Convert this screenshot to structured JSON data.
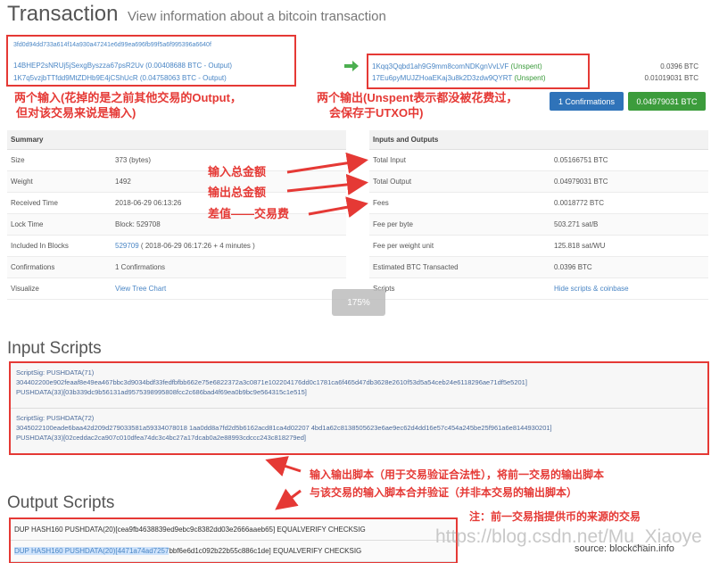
{
  "header": {
    "title": "Transaction",
    "subtitle": "View information about a bitcoin transaction"
  },
  "tx": {
    "hash": "3fd0d94dd733a614f14a930a47241e6d99ea696fb99f5a6f995396a6640f",
    "inputs": [
      {
        "address": "14BHEP2sNRUj5jSexgByszza67psR2Uv",
        "amount": "(0.00408688 BTC - Output)"
      },
      {
        "address": "1K7q5vzjbTTfdd9MtZDHb9E4jCShUcR",
        "amount": "(0.04758063 BTC - Output)"
      }
    ],
    "outputs": [
      {
        "address": "1Kqq3Qqbd1ah9G9mm8comNDKgnVvLVF",
        "status": "(Unspent)",
        "amount": "0.0396 BTC"
      },
      {
        "address": "17Eu6pyMUJZHoaEKaj3u8k2D3zdw9QYRT",
        "status": "(Unspent)",
        "amount": "0.01019031 BTC"
      }
    ],
    "confirmations_button": "1 Confirmations",
    "total_button": "0.04979031 BTC"
  },
  "notes": {
    "inputs_line1": "两个输入(花掉的是之前其他交易的Output，",
    "inputs_line2": "但对该交易来说是输入)",
    "outputs_line1": "两个输出(Unspent表示都没被花费过，",
    "outputs_line2": "会保存于UTXO中)",
    "total_input": "输入总金额",
    "total_output": "输出总金额",
    "fee": "差值——交易费",
    "scripts_line1": "输入输出脚本（用于交易验证合法性），将前一交易的输出脚本",
    "scripts_line2": "与该交易的输入脚本合并验证（并非本交易的输出脚本）",
    "prev_tx": "注：前一交易指提供币的来源的交易"
  },
  "summary": {
    "heading": "Summary",
    "rows": [
      {
        "key": "Size",
        "value": "373 (bytes)"
      },
      {
        "key": "Weight",
        "value": "1492"
      },
      {
        "key": "Received Time",
        "value": "2018-06-29 06:13:26"
      },
      {
        "key": "Lock Time",
        "value": "Block: 529708"
      },
      {
        "key": "Included In Blocks",
        "value_link": "529709",
        "value_rest": " ( 2018-06-29 06:17:26 + 4 minutes )"
      },
      {
        "key": "Confirmations",
        "value": "1 Confirmations"
      },
      {
        "key": "Visualize",
        "value_link": "View Tree Chart",
        "value_rest": ""
      }
    ]
  },
  "io": {
    "heading": "Inputs and Outputs",
    "rows": [
      {
        "key": "Total Input",
        "value": "0.05166751 BTC"
      },
      {
        "key": "Total Output",
        "value": "0.04979031 BTC"
      },
      {
        "key": "Fees",
        "value": "0.0018772 BTC"
      },
      {
        "key": "Fee per byte",
        "value": "503.271 sat/B"
      },
      {
        "key": "Fee per weight unit",
        "value": "125.818 sat/WU"
      },
      {
        "key": "Estimated BTC Transacted",
        "value": "0.0396 BTC"
      },
      {
        "key": "Scripts",
        "value_link": "Hide scripts & coinbase",
        "value_rest": ""
      }
    ]
  },
  "zoom": "175%",
  "input_scripts": {
    "title": "Input Scripts",
    "blocks": [
      {
        "line1": "ScriptSig: PUSHDATA(71)",
        "line2": "304402200e902feaaf8e49ea467bbc3d9034bdf33fedfbfbb662e75e6822372a3c0871e102204176dd0c1781ca6f465d47db3628e2610f53d5a54ceb24e6118296ae71df5e5201]",
        "line3": "PUSHDATA(33)[03b339dc9b56131ad9575398995808fcc2c686bad4f69ea0b9bc9e564315c1e515]"
      },
      {
        "line1": "ScriptSig: PUSHDATA(72)",
        "line2": "3045022100eade6baa42d209d279033581a59334078018 1aa0dd8a7fd2d5b6162acd81ca4d02207 4bd1a62c8138505623e6ae9ec62d4dd16e57c454a245be25f961a6e8144930201]",
        "line3": "PUSHDATA(33)[02ceddac2ca907c010dfea74dc3c4bc27a17dcab0a2e88993cdccc243c818279ed]"
      }
    ]
  },
  "output_scripts": {
    "title": "Output Scripts",
    "rows": [
      {
        "pre": "DUP HASH160 PUSHDATA(20)[cea9fb4638839ed9ebc9c8382dd03e2666aaeb65] EQUALVERIFY CHECKSIG",
        "hl": "",
        "post": ""
      },
      {
        "pre": "DUP HASH160 PUSHDATA(20)[",
        "hl": "4471a74ad7257",
        "post": "bbf6e6d1c092b22b55c886c1de] EQUALVERIFY CHECKSIG"
      }
    ]
  },
  "watermark": "https://blog.csdn.net/Mu_Xiaoye",
  "source": "source: blockchain.info",
  "colors": {
    "annotation": "#e53935",
    "link": "#4a86c5",
    "unspent": "#3a9a3a",
    "confirm_btn": "#2f73b9",
    "total_btn": "#3c9c3c"
  }
}
